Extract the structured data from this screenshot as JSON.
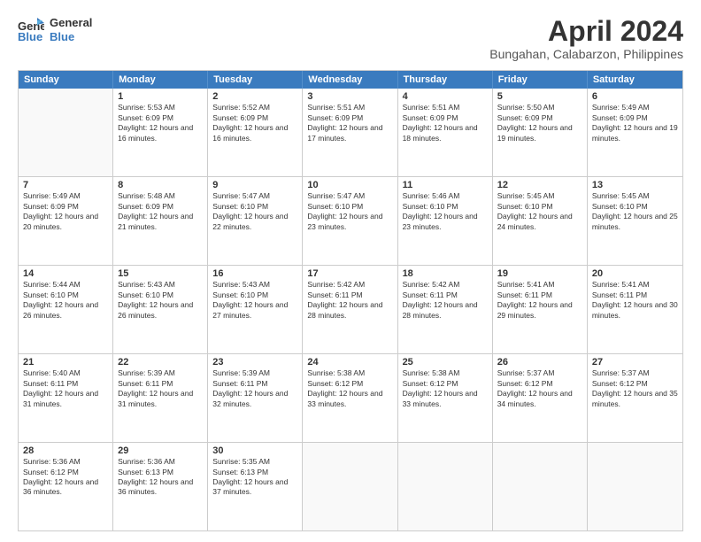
{
  "logo": {
    "line1": "General",
    "line2": "Blue"
  },
  "title": "April 2024",
  "subtitle": "Bungahan, Calabarzon, Philippines",
  "header_days": [
    "Sunday",
    "Monday",
    "Tuesday",
    "Wednesday",
    "Thursday",
    "Friday",
    "Saturday"
  ],
  "weeks": [
    [
      {
        "day": "",
        "sunrise": "",
        "sunset": "",
        "daylight": ""
      },
      {
        "day": "1",
        "sunrise": "Sunrise: 5:53 AM",
        "sunset": "Sunset: 6:09 PM",
        "daylight": "Daylight: 12 hours and 16 minutes."
      },
      {
        "day": "2",
        "sunrise": "Sunrise: 5:52 AM",
        "sunset": "Sunset: 6:09 PM",
        "daylight": "Daylight: 12 hours and 16 minutes."
      },
      {
        "day": "3",
        "sunrise": "Sunrise: 5:51 AM",
        "sunset": "Sunset: 6:09 PM",
        "daylight": "Daylight: 12 hours and 17 minutes."
      },
      {
        "day": "4",
        "sunrise": "Sunrise: 5:51 AM",
        "sunset": "Sunset: 6:09 PM",
        "daylight": "Daylight: 12 hours and 18 minutes."
      },
      {
        "day": "5",
        "sunrise": "Sunrise: 5:50 AM",
        "sunset": "Sunset: 6:09 PM",
        "daylight": "Daylight: 12 hours and 19 minutes."
      },
      {
        "day": "6",
        "sunrise": "Sunrise: 5:49 AM",
        "sunset": "Sunset: 6:09 PM",
        "daylight": "Daylight: 12 hours and 19 minutes."
      }
    ],
    [
      {
        "day": "7",
        "sunrise": "Sunrise: 5:49 AM",
        "sunset": "Sunset: 6:09 PM",
        "daylight": "Daylight: 12 hours and 20 minutes."
      },
      {
        "day": "8",
        "sunrise": "Sunrise: 5:48 AM",
        "sunset": "Sunset: 6:09 PM",
        "daylight": "Daylight: 12 hours and 21 minutes."
      },
      {
        "day": "9",
        "sunrise": "Sunrise: 5:47 AM",
        "sunset": "Sunset: 6:10 PM",
        "daylight": "Daylight: 12 hours and 22 minutes."
      },
      {
        "day": "10",
        "sunrise": "Sunrise: 5:47 AM",
        "sunset": "Sunset: 6:10 PM",
        "daylight": "Daylight: 12 hours and 23 minutes."
      },
      {
        "day": "11",
        "sunrise": "Sunrise: 5:46 AM",
        "sunset": "Sunset: 6:10 PM",
        "daylight": "Daylight: 12 hours and 23 minutes."
      },
      {
        "day": "12",
        "sunrise": "Sunrise: 5:45 AM",
        "sunset": "Sunset: 6:10 PM",
        "daylight": "Daylight: 12 hours and 24 minutes."
      },
      {
        "day": "13",
        "sunrise": "Sunrise: 5:45 AM",
        "sunset": "Sunset: 6:10 PM",
        "daylight": "Daylight: 12 hours and 25 minutes."
      }
    ],
    [
      {
        "day": "14",
        "sunrise": "Sunrise: 5:44 AM",
        "sunset": "Sunset: 6:10 PM",
        "daylight": "Daylight: 12 hours and 26 minutes."
      },
      {
        "day": "15",
        "sunrise": "Sunrise: 5:43 AM",
        "sunset": "Sunset: 6:10 PM",
        "daylight": "Daylight: 12 hours and 26 minutes."
      },
      {
        "day": "16",
        "sunrise": "Sunrise: 5:43 AM",
        "sunset": "Sunset: 6:10 PM",
        "daylight": "Daylight: 12 hours and 27 minutes."
      },
      {
        "day": "17",
        "sunrise": "Sunrise: 5:42 AM",
        "sunset": "Sunset: 6:11 PM",
        "daylight": "Daylight: 12 hours and 28 minutes."
      },
      {
        "day": "18",
        "sunrise": "Sunrise: 5:42 AM",
        "sunset": "Sunset: 6:11 PM",
        "daylight": "Daylight: 12 hours and 28 minutes."
      },
      {
        "day": "19",
        "sunrise": "Sunrise: 5:41 AM",
        "sunset": "Sunset: 6:11 PM",
        "daylight": "Daylight: 12 hours and 29 minutes."
      },
      {
        "day": "20",
        "sunrise": "Sunrise: 5:41 AM",
        "sunset": "Sunset: 6:11 PM",
        "daylight": "Daylight: 12 hours and 30 minutes."
      }
    ],
    [
      {
        "day": "21",
        "sunrise": "Sunrise: 5:40 AM",
        "sunset": "Sunset: 6:11 PM",
        "daylight": "Daylight: 12 hours and 31 minutes."
      },
      {
        "day": "22",
        "sunrise": "Sunrise: 5:39 AM",
        "sunset": "Sunset: 6:11 PM",
        "daylight": "Daylight: 12 hours and 31 minutes."
      },
      {
        "day": "23",
        "sunrise": "Sunrise: 5:39 AM",
        "sunset": "Sunset: 6:11 PM",
        "daylight": "Daylight: 12 hours and 32 minutes."
      },
      {
        "day": "24",
        "sunrise": "Sunrise: 5:38 AM",
        "sunset": "Sunset: 6:12 PM",
        "daylight": "Daylight: 12 hours and 33 minutes."
      },
      {
        "day": "25",
        "sunrise": "Sunrise: 5:38 AM",
        "sunset": "Sunset: 6:12 PM",
        "daylight": "Daylight: 12 hours and 33 minutes."
      },
      {
        "day": "26",
        "sunrise": "Sunrise: 5:37 AM",
        "sunset": "Sunset: 6:12 PM",
        "daylight": "Daylight: 12 hours and 34 minutes."
      },
      {
        "day": "27",
        "sunrise": "Sunrise: 5:37 AM",
        "sunset": "Sunset: 6:12 PM",
        "daylight": "Daylight: 12 hours and 35 minutes."
      }
    ],
    [
      {
        "day": "28",
        "sunrise": "Sunrise: 5:36 AM",
        "sunset": "Sunset: 6:12 PM",
        "daylight": "Daylight: 12 hours and 36 minutes."
      },
      {
        "day": "29",
        "sunrise": "Sunrise: 5:36 AM",
        "sunset": "Sunset: 6:13 PM",
        "daylight": "Daylight: 12 hours and 36 minutes."
      },
      {
        "day": "30",
        "sunrise": "Sunrise: 5:35 AM",
        "sunset": "Sunset: 6:13 PM",
        "daylight": "Daylight: 12 hours and 37 minutes."
      },
      {
        "day": "",
        "sunrise": "",
        "sunset": "",
        "daylight": ""
      },
      {
        "day": "",
        "sunrise": "",
        "sunset": "",
        "daylight": ""
      },
      {
        "day": "",
        "sunrise": "",
        "sunset": "",
        "daylight": ""
      },
      {
        "day": "",
        "sunrise": "",
        "sunset": "",
        "daylight": ""
      }
    ]
  ]
}
